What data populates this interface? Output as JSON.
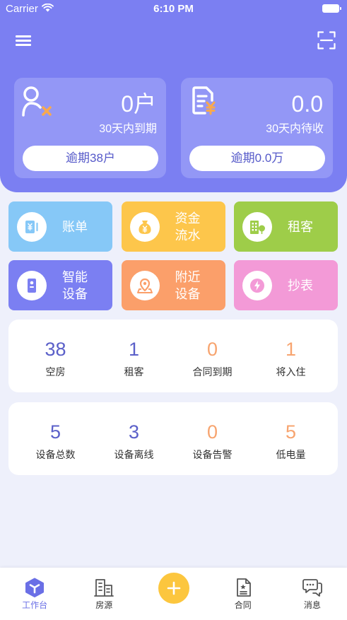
{
  "status_bar": {
    "carrier": "Carrier",
    "time": "6:10 PM"
  },
  "colors": {
    "header": "#7b7ff2",
    "summary_card": "#9397f6"
  },
  "summary": [
    {
      "icon": "tenant-alert-icon",
      "value": "0户",
      "caption": "30天内到期",
      "button": "逾期38户"
    },
    {
      "icon": "receivable-doc-icon",
      "value": "0.0",
      "caption": "30天内待收",
      "button": "逾期0.0万"
    }
  ],
  "tiles": [
    {
      "icon": "bill-icon",
      "line1": "账单",
      "color": "#86c8f7"
    },
    {
      "icon": "money-bag-icon",
      "line1": "资金",
      "line2": "流水",
      "color": "#fdc64b"
    },
    {
      "icon": "building-icon",
      "line1": "租客",
      "color": "#9ecd49"
    },
    {
      "icon": "smart-device-icon",
      "line1": "智能",
      "line2": "设备",
      "color": "#7b7ff2"
    },
    {
      "icon": "location-pin-icon",
      "line1": "附近",
      "line2": "设备",
      "color": "#fb9f6a"
    },
    {
      "icon": "lightning-icon",
      "line1": "抄表",
      "color": "#f39ad7"
    }
  ],
  "room_stats": [
    {
      "value": "38",
      "label": "空房",
      "color": "#5b60c9"
    },
    {
      "value": "1",
      "label": "租客",
      "color": "#5b60c9"
    },
    {
      "value": "0",
      "label": "合同到期",
      "color": "#f7a46f"
    },
    {
      "value": "1",
      "label": "将入住",
      "color": "#f7a46f"
    }
  ],
  "device_stats": [
    {
      "value": "5",
      "label": "设备总数",
      "color": "#5b60c9"
    },
    {
      "value": "3",
      "label": "设备离线",
      "color": "#5b60c9"
    },
    {
      "value": "0",
      "label": "设备告警",
      "color": "#f7a46f"
    },
    {
      "value": "5",
      "label": "低电量",
      "color": "#f7a46f"
    }
  ],
  "tabbar": {
    "active_index": 0,
    "tabs": [
      {
        "icon": "workbench-icon",
        "label": "工作台"
      },
      {
        "icon": "buildings-icon",
        "label": "房源"
      },
      {
        "icon": "plus-icon"
      },
      {
        "icon": "contract-icon",
        "label": "合同"
      },
      {
        "icon": "message-icon",
        "label": "消息"
      }
    ]
  }
}
